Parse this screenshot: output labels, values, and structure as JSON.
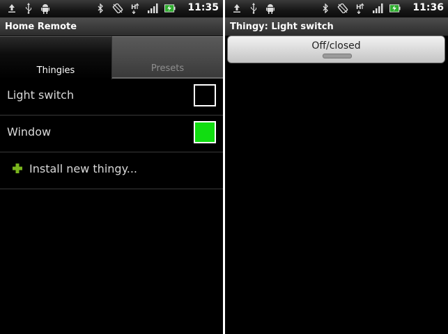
{
  "left": {
    "status_time": "11:35",
    "title": "Home Remote",
    "tabs": [
      {
        "label": "Thingies",
        "active": true
      },
      {
        "label": "Presets",
        "active": false
      }
    ],
    "items": [
      {
        "label": "Light switch",
        "state_color": "#000000"
      },
      {
        "label": "Window",
        "state_color": "#11dd11"
      }
    ],
    "install_label": "Install new thingy..."
  },
  "right": {
    "status_time": "11:36",
    "title": "Thingy: Light switch",
    "toggle_label": "Off/closed"
  },
  "status_icons": [
    "upload-icon",
    "usb-icon",
    "android-debug-icon",
    "bluetooth-icon",
    "rotation-icon",
    "data-transfer-icon",
    "signal-icon",
    "battery-charging-icon"
  ],
  "colors": {
    "accent_green": "#7ab51d",
    "active_state": "#11dd11"
  }
}
